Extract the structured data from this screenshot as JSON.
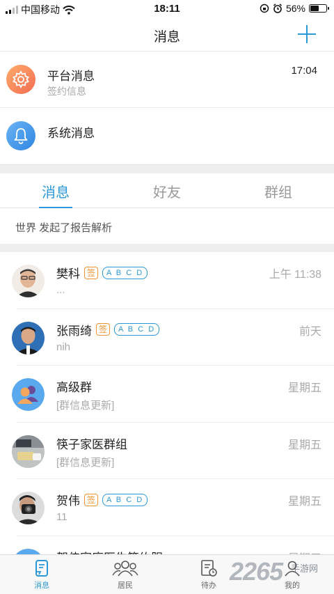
{
  "status_bar": {
    "carrier": "中国移动",
    "time": "18:11",
    "battery_percent": "56%",
    "battery_level": 0.56
  },
  "nav": {
    "title": "消息",
    "add_icon": "plus-icon"
  },
  "system_rows": [
    {
      "title": "平台消息",
      "subtitle": "签约信息",
      "time": "17:04",
      "icon": "gear-icon"
    },
    {
      "title": "系统消息",
      "subtitle": "",
      "time": "",
      "icon": "bell-icon"
    }
  ],
  "tabs": [
    {
      "label": "消息",
      "active": true
    },
    {
      "label": "好友",
      "active": false
    },
    {
      "label": "群组",
      "active": false
    }
  ],
  "notice": "世界 发起了报告解析",
  "conversations": [
    {
      "name": "樊科",
      "sign_tag": "签",
      "abcd_tag": "A B C D",
      "preview": "...",
      "time": "上午 11:38"
    },
    {
      "name": "张雨绮",
      "sign_tag": "签",
      "abcd_tag": "A B C D",
      "preview": "nih",
      "time": "前天"
    },
    {
      "name": "高级群",
      "sign_tag": "",
      "abcd_tag": "",
      "preview": "[群信息更新]",
      "time": "星期五"
    },
    {
      "name": "筷子家医群组",
      "sign_tag": "",
      "abcd_tag": "",
      "preview": "[群信息更新]",
      "time": "星期五"
    },
    {
      "name": "贺伟",
      "sign_tag": "签",
      "abcd_tag": "A B C D",
      "preview": "11",
      "time": "星期五"
    },
    {
      "name": "贺伟家庭医生签约服",
      "sign_tag": "",
      "abcd_tag": "",
      "preview": "",
      "time": "星期五"
    }
  ],
  "tab_bar": [
    {
      "label": "消息",
      "icon": "message-icon",
      "active": true
    },
    {
      "label": "居民",
      "icon": "residents-icon",
      "active": false
    },
    {
      "label": "待办",
      "icon": "todo-icon",
      "active": false
    },
    {
      "label": "我的",
      "icon": "profile-icon",
      "active": false
    }
  ],
  "watermark": {
    "main": "2265",
    "sub": "手游网"
  },
  "colors": {
    "accent": "#2a97d8",
    "tag_orange": "#f09432",
    "divider_bg": "#eeeeee"
  }
}
